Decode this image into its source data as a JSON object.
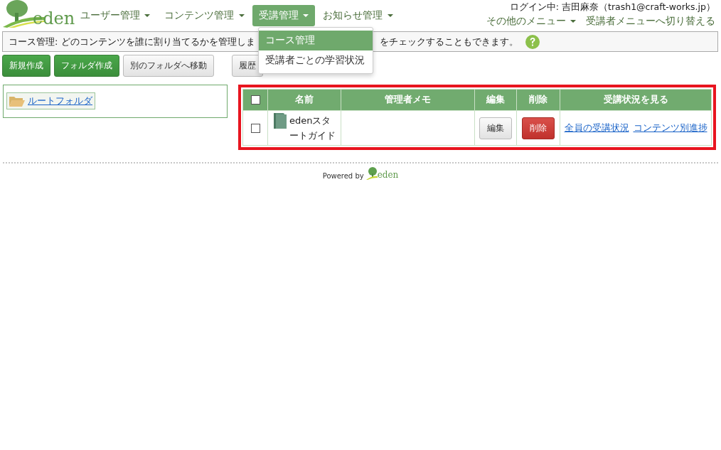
{
  "logo": {
    "text": "eden"
  },
  "nav": [
    {
      "label": "ユーザー管理",
      "selected": false
    },
    {
      "label": "コンテンツ管理",
      "selected": false
    },
    {
      "label": "受講管理",
      "selected": true
    },
    {
      "label": "お知らせ管理",
      "selected": false
    }
  ],
  "dropdown": [
    {
      "label": "コース管理",
      "selected": true
    },
    {
      "label": "受講者ごとの学習状況",
      "selected": false
    }
  ],
  "login": "ログイン中: 吉田麻奈（trash1@craft-works.jp）",
  "other_menu": "その他のメニュー",
  "switch_link": "受講者メニューへ切り替える",
  "info": {
    "text_before": "コース管理: どのコンテンツを誰に割り当てるかを管理しま",
    "text_after": "をチェックすることもできます。"
  },
  "toolbar": [
    {
      "label": "新規作成",
      "kind": "primary"
    },
    {
      "label": "フォルダ作成",
      "kind": "primary"
    },
    {
      "label": "別のフォルダへ移動",
      "kind": "default"
    },
    {
      "label": "履歴",
      "kind": "default"
    }
  ],
  "folder": {
    "label": "ルートフォルダ"
  },
  "table": {
    "columns": [
      "名前",
      "管理者メモ",
      "編集",
      "削除",
      "受講状況を見る"
    ],
    "header_checked": false,
    "rows": [
      {
        "checked": false,
        "name": "edenスタートガイド",
        "edit": "編集",
        "delete": "削除",
        "links": [
          "全員の受講状況",
          "コンテンツ別進捗"
        ]
      }
    ]
  },
  "footer": {
    "powered_by": "Powered by",
    "logo_text": "eden"
  }
}
